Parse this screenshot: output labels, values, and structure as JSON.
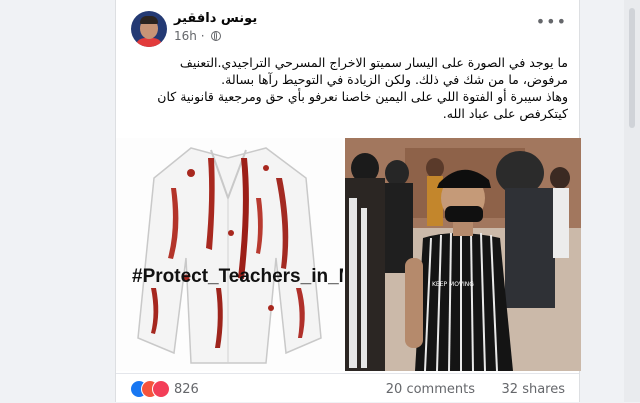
{
  "post": {
    "author": "يونس دافقير",
    "time": "16h",
    "privacy_icon": "globe-icon",
    "more_icon": "more-options-icon",
    "text_lines": [
      "ما يوجد في الصورة على اليسار سميتو الاخراج المسرحي التراجيدي.التعنيف مرفوض، ما من شك في ذلك. ولكن الزيادة في التوحيط رآها بسالة.",
      "وهاذ سيبرة أو الفتوة اللي على اليمين خاصنا نعرفو بأي حق ومرجعية قانونية كان كيتكرفص على عباد الله."
    ]
  },
  "media": {
    "left_image_caption": "#Protect_Teachers_in_Morocco",
    "right_image_shirt_text": "KEEP MOVING"
  },
  "footer": {
    "reaction_icons": [
      "like-icon",
      "angry-icon",
      "love-icon"
    ],
    "reaction_count": "826",
    "comments": "20 comments",
    "shares": "32 shares"
  }
}
